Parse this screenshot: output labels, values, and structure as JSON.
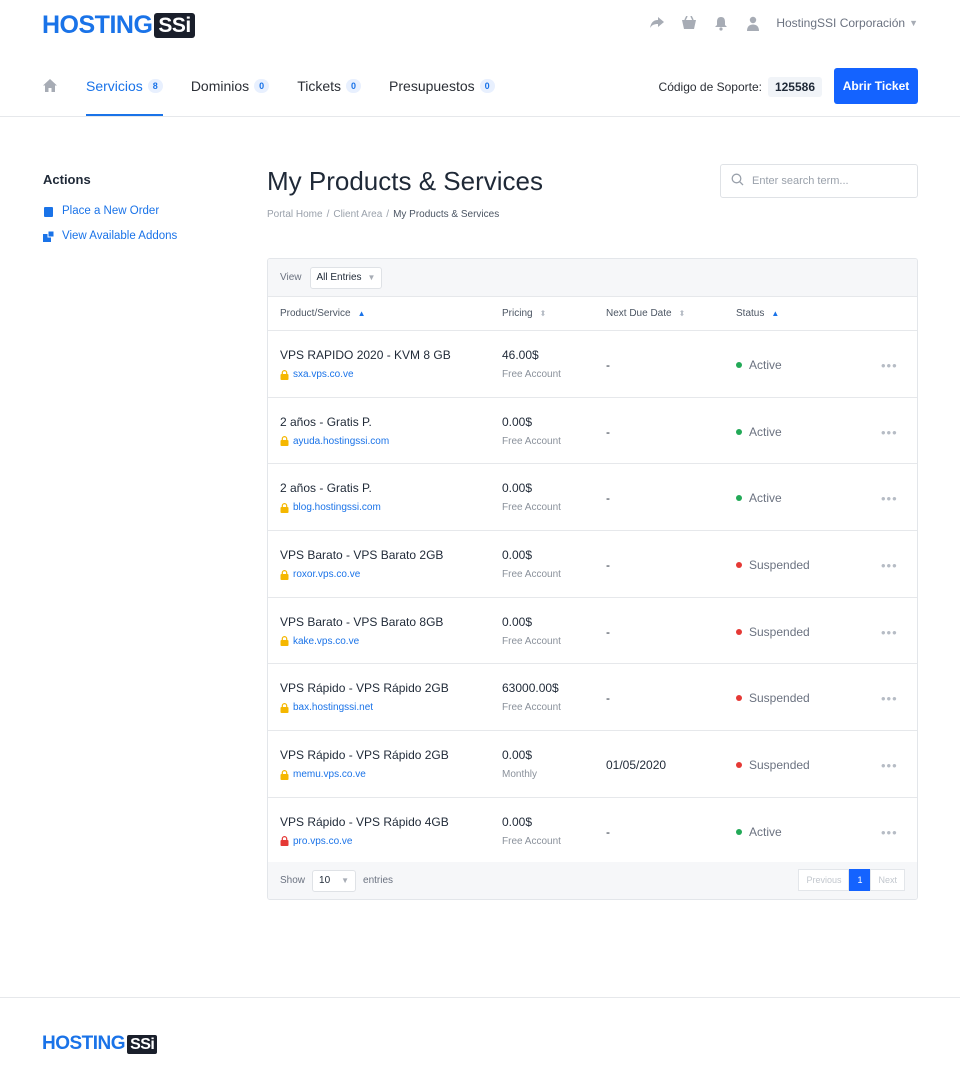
{
  "brand": {
    "name_part1": "HOSTING",
    "name_part2": "SSi"
  },
  "header": {
    "user_name": "HostingSSI Corporación",
    "icons": [
      "share-icon",
      "basket-icon",
      "bell-icon",
      "user-icon"
    ]
  },
  "nav": {
    "items": [
      {
        "label": "Servicios",
        "count": "8",
        "active": true
      },
      {
        "label": "Dominios",
        "count": "0"
      },
      {
        "label": "Tickets",
        "count": "0"
      },
      {
        "label": "Presupuestos",
        "count": "0"
      }
    ],
    "support_label": "Código de Soporte:",
    "support_code": "125586",
    "open_ticket_label": "Abrir Ticket"
  },
  "sidebar": {
    "title": "Actions",
    "links": [
      {
        "label": "Place a New Order",
        "icon": "cart-icon"
      },
      {
        "label": "View Available Addons",
        "icon": "addons-icon"
      }
    ]
  },
  "main": {
    "title": "My Products & Services",
    "breadcrumb": [
      "Portal Home",
      "Client Area",
      "My Products & Services"
    ],
    "search_placeholder": "Enter search term..."
  },
  "table": {
    "view_label": "View",
    "view_value": "All Entries",
    "columns": [
      "Product/Service",
      "Pricing",
      "Next Due Date",
      "Status"
    ],
    "rows": [
      {
        "product": "VPS RAPIDO 2020 - KVM 8 GB",
        "domain": "sxa.vps.co.ve",
        "lock": "yellow",
        "price": "46.00$",
        "cycle": "Free Account",
        "due": "-",
        "status": "Active"
      },
      {
        "product": "2 años - Gratis P.",
        "domain": "ayuda.hostingssi.com",
        "lock": "yellow",
        "price": "0.00$",
        "cycle": "Free Account",
        "due": "-",
        "status": "Active"
      },
      {
        "product": "2 años - Gratis P.",
        "domain": "blog.hostingssi.com",
        "lock": "yellow",
        "price": "0.00$",
        "cycle": "Free Account",
        "due": "-",
        "status": "Active"
      },
      {
        "product": "VPS Barato - VPS Barato 2GB",
        "domain": "roxor.vps.co.ve",
        "lock": "yellow",
        "price": "0.00$",
        "cycle": "Free Account",
        "due": "-",
        "status": "Suspended"
      },
      {
        "product": "VPS Barato - VPS Barato 8GB",
        "domain": "kake.vps.co.ve",
        "lock": "yellow",
        "price": "0.00$",
        "cycle": "Free Account",
        "due": "-",
        "status": "Suspended"
      },
      {
        "product": "VPS Rápido - VPS Rápido 2GB",
        "domain": "bax.hostingssi.net",
        "lock": "yellow",
        "price": "63000.00$",
        "cycle": "Free Account",
        "due": "-",
        "status": "Suspended"
      },
      {
        "product": "VPS Rápido - VPS Rápido 2GB",
        "domain": "memu.vps.co.ve",
        "lock": "yellow",
        "price": "0.00$",
        "cycle": "Monthly",
        "due": "01/05/2020",
        "status": "Suspended"
      },
      {
        "product": "VPS Rápido - VPS Rápido 4GB",
        "domain": "pro.vps.co.ve",
        "lock": "red",
        "price": "0.00$",
        "cycle": "Free Account",
        "due": "-",
        "status": "Active"
      }
    ],
    "footer": {
      "show_label": "Show",
      "show_value": "10",
      "entries_label": "entries",
      "pager": [
        "Previous",
        "1",
        "Next"
      ]
    }
  },
  "colors": {
    "accent": "#1a73e8",
    "button": "#1463ff",
    "active_status": "#22a957",
    "suspended_status": "#e53935",
    "lock_yellow": "#f5b700",
    "lock_red": "#e53935"
  }
}
